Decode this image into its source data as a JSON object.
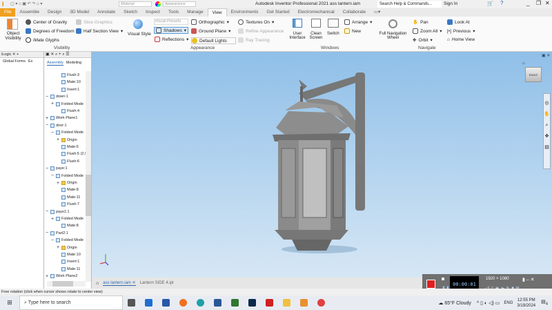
{
  "titlebar": {
    "material": "Material",
    "appearance": "Appearance",
    "title": "Autodesk Inventor Professional 2021   ass lantern.iam",
    "search_placeholder": "Search Help & Commands...",
    "sign_in": "Sign In"
  },
  "tabs": [
    "File",
    "Assemble",
    "Design",
    "3D Model",
    "Annotate",
    "Sketch",
    "Inspect",
    "Tools",
    "Manage",
    "View",
    "Environments",
    "Get Started",
    "Electromechanical",
    "Collaborate"
  ],
  "active_tab": "View",
  "ribbon": {
    "object_visibility": "Object Visibility",
    "center_of_gravity": "Center of Gravity",
    "degrees_of_freedom": "Degrees of Freedom",
    "imate_glyphs": "iMate Glyphs",
    "slice_graphics": "Slice Graphics",
    "half_section_view": "Half Section View",
    "visibility_group": "Visibility",
    "visual_style": "Visual Style",
    "visual_presets": "Visual Presets",
    "shadows": "Shadows",
    "reflections": "Reflections",
    "orthographic": "Orthographic",
    "ground_plane": "Ground Plane",
    "default_lights": "Default Lights",
    "textures_on": "Textures On",
    "refine_appearance": "Refine Appearance",
    "ray_tracing": "Ray Tracing",
    "appearance_group": "Appearance",
    "user_interface": "User Interface",
    "clean_screen": "Clean Screen",
    "switch": "Switch",
    "arrange": "Arrange",
    "new": "New",
    "windows_group": "Windows",
    "full_navigation_wheel": "Full Navigation Wheel",
    "pan": "Pan",
    "zoom_all": "Zoom All",
    "orbit": "Orbit",
    "look_at": "Look At",
    "previous": "Previous",
    "home_view": "Home View",
    "navigate_group": "Navigate"
  },
  "left_panel": {
    "tab": "iLogic",
    "global_forms": "Global Forms",
    "ex": "Ex"
  },
  "browser": {
    "tabs": [
      "Assembly",
      "Modeling"
    ],
    "active_tab": "Assembly",
    "items": [
      {
        "label": "Flush:3",
        "level": 2,
        "exp": "",
        "icon": "constraint"
      },
      {
        "label": "Mate:10",
        "level": 2,
        "exp": "",
        "icon": "constraint"
      },
      {
        "label": "Insert:1",
        "level": 2,
        "exp": "",
        "icon": "constraint"
      },
      {
        "label": "down:1",
        "level": 0,
        "exp": "−",
        "icon": "part"
      },
      {
        "label": "Folded Mode",
        "level": 1,
        "exp": "+",
        "icon": "sheet"
      },
      {
        "label": "Flush:4",
        "level": 2,
        "exp": "",
        "icon": "constraint"
      },
      {
        "label": "Work Plane1",
        "level": 0,
        "exp": "+",
        "icon": "plane"
      },
      {
        "label": "door:1",
        "level": 0,
        "exp": "−",
        "icon": "part"
      },
      {
        "label": "Folded Mode",
        "level": 1,
        "exp": "−",
        "icon": "sheet"
      },
      {
        "label": "Origin",
        "level": 2,
        "exp": "+",
        "icon": "folder"
      },
      {
        "label": "Mate:6",
        "level": 2,
        "exp": "",
        "icon": "constraint"
      },
      {
        "label": "Flush:5 (2.5r",
        "level": 2,
        "exp": "",
        "icon": "constraint"
      },
      {
        "label": "Flush:6",
        "level": 2,
        "exp": "",
        "icon": "constraint"
      },
      {
        "label": "paye:1",
        "level": 0,
        "exp": "−",
        "icon": "part"
      },
      {
        "label": "Folded Mode",
        "level": 1,
        "exp": "−",
        "icon": "sheet"
      },
      {
        "label": "Origin",
        "level": 2,
        "exp": "+",
        "icon": "folder"
      },
      {
        "label": "Mate:8",
        "level": 2,
        "exp": "",
        "icon": "constraint"
      },
      {
        "label": "Mate:11",
        "level": 2,
        "exp": "",
        "icon": "constraint"
      },
      {
        "label": "Flush:7",
        "level": 2,
        "exp": "",
        "icon": "constraint"
      },
      {
        "label": "paye1:1",
        "level": 0,
        "exp": "−",
        "icon": "part"
      },
      {
        "label": "Folded Mode",
        "level": 1,
        "exp": "+",
        "icon": "sheet"
      },
      {
        "label": "Mate:8",
        "level": 2,
        "exp": "",
        "icon": "constraint"
      },
      {
        "label": "Part2:1",
        "level": 0,
        "exp": "−",
        "icon": "part"
      },
      {
        "label": "Folded Mode",
        "level": 1,
        "exp": "−",
        "icon": "sheet"
      },
      {
        "label": "Origin",
        "level": 2,
        "exp": "+",
        "icon": "folder"
      },
      {
        "label": "Mate:10",
        "level": 2,
        "exp": "",
        "icon": "constraint"
      },
      {
        "label": "Insert:1",
        "level": 2,
        "exp": "",
        "icon": "constraint"
      },
      {
        "label": "Mate:11",
        "level": 2,
        "exp": "",
        "icon": "constraint"
      },
      {
        "label": "Work Plane2",
        "level": 0,
        "exp": "+",
        "icon": "plane"
      }
    ]
  },
  "viewcube": {
    "face": "RIGHT"
  },
  "doc_tabs": [
    "ass lantern.iam",
    "Lantern SIDE 4.ipt"
  ],
  "active_doc": "ass lantern.iam",
  "status": "Free rotation (click when cursor shows rotate to center view)",
  "recorder": {
    "timer": "00:00:01",
    "resolution": "1920 × 1080"
  },
  "taskbar": {
    "search_placeholder": "Type here to search",
    "weather": "65°F  Cloudy",
    "lang": "ENG",
    "time": "12:55 PM",
    "date": "3/19/2024",
    "notifications": "4"
  },
  "colors": {
    "file_tab": "#f0a020",
    "viewport_top": "#8fbfe8",
    "viewport_bottom": "#d6e7f5",
    "lantern": "#8a8a8a"
  }
}
